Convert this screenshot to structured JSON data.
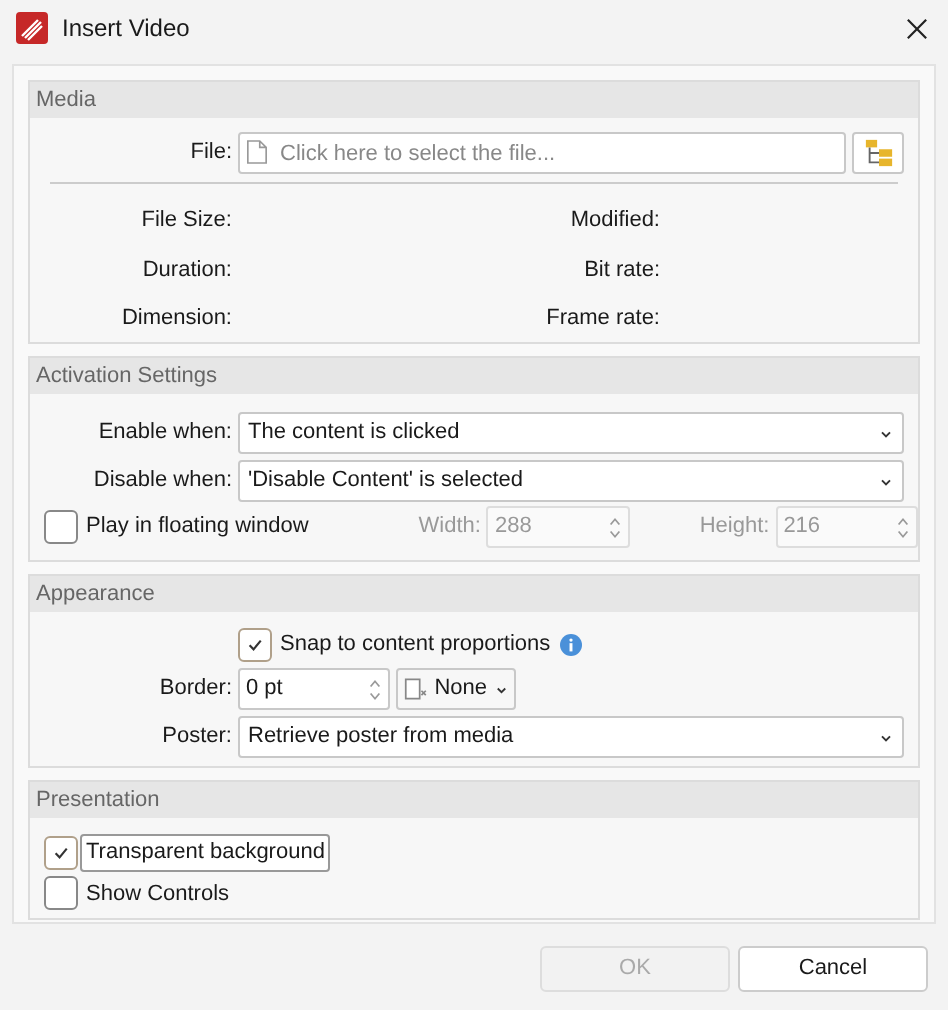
{
  "window": {
    "title": "Insert Video"
  },
  "media": {
    "title": "Media",
    "file": {
      "label": "File:",
      "placeholder": "Click here to select the file..."
    },
    "info": [
      {
        "left": "File Size:",
        "right": "Modified:"
      },
      {
        "left": "Duration:",
        "right": "Bit rate:"
      },
      {
        "left": "Dimension:",
        "right": "Frame rate:"
      }
    ]
  },
  "activation": {
    "title": "Activation Settings",
    "enable": {
      "label": "Enable when:",
      "value": "The content is clicked"
    },
    "disable": {
      "label": "Disable when:",
      "value": "'Disable Content' is selected"
    },
    "floating": {
      "label": "Play in floating window",
      "checked": false
    },
    "width": {
      "label": "Width:",
      "value": "288",
      "disabled": true
    },
    "height": {
      "label": "Height:",
      "value": "216",
      "disabled": true
    }
  },
  "appearance": {
    "title": "Appearance",
    "snap": {
      "label": "Snap to content proportions",
      "checked": true
    },
    "border": {
      "label": "Border:",
      "value": "0 pt"
    },
    "border_style": {
      "value": "None"
    },
    "poster": {
      "label": "Poster:",
      "value": "Retrieve poster from media"
    }
  },
  "presentation": {
    "title": "Presentation",
    "options": [
      {
        "label": "Transparent background",
        "checked": true,
        "focused": true
      },
      {
        "label": "Show Controls",
        "checked": false,
        "focused": false
      }
    ]
  },
  "buttons": [
    {
      "label": "OK",
      "disabled": true
    },
    {
      "label": "Cancel",
      "disabled": false
    }
  ]
}
